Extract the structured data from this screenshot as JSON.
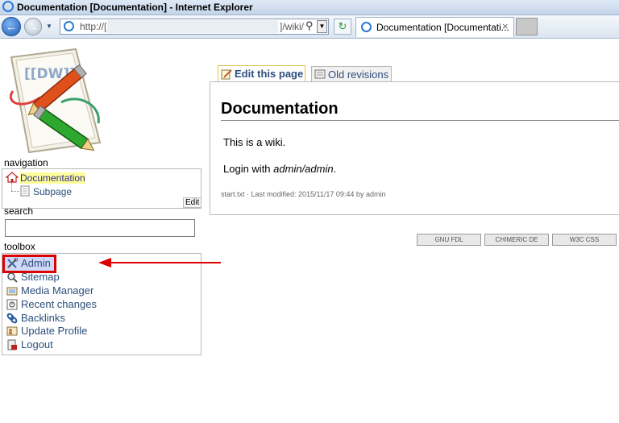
{
  "window": {
    "title": "Documentation [Documentation] - Internet Explorer"
  },
  "browser": {
    "address_prefix": "http://[",
    "address_suffix": "]/wiki/",
    "tab_title": "Documentation [Documentati...",
    "tab_close": "×"
  },
  "sidebar": {
    "navigation_label": "navigation",
    "nav_items": [
      {
        "label": "Documentation"
      },
      {
        "label": "Subpage"
      }
    ],
    "edit_label": "Edit",
    "search_label": "search",
    "search_value": "",
    "toolbox_label": "toolbox",
    "tools": [
      {
        "label": "Admin"
      },
      {
        "label": "Sitemap"
      },
      {
        "label": "Media Manager"
      },
      {
        "label": "Recent changes"
      },
      {
        "label": "Backlinks"
      },
      {
        "label": "Update Profile"
      },
      {
        "label": "Logout"
      }
    ]
  },
  "main": {
    "tabs": [
      {
        "label": "Edit this page"
      },
      {
        "label": "Old revisions"
      }
    ],
    "title": "Documentation",
    "paragraph1": "This is a wiki.",
    "login_prefix": "Login with ",
    "login_credentials": "admin/admin",
    "login_suffix": ".",
    "meta": "start.txt · Last modified: 2015/11/17 09:44 by admin"
  },
  "badges": [
    {
      "label": "GNU FDL"
    },
    {
      "label": "CHIMERIC  DE"
    },
    {
      "label": "W3C  CSS"
    }
  ],
  "colors": {
    "highlight_border": "#dd0000",
    "arrow": "#dd0000",
    "link": "#2c4f7c",
    "current_page_bg": "#ffff99"
  }
}
